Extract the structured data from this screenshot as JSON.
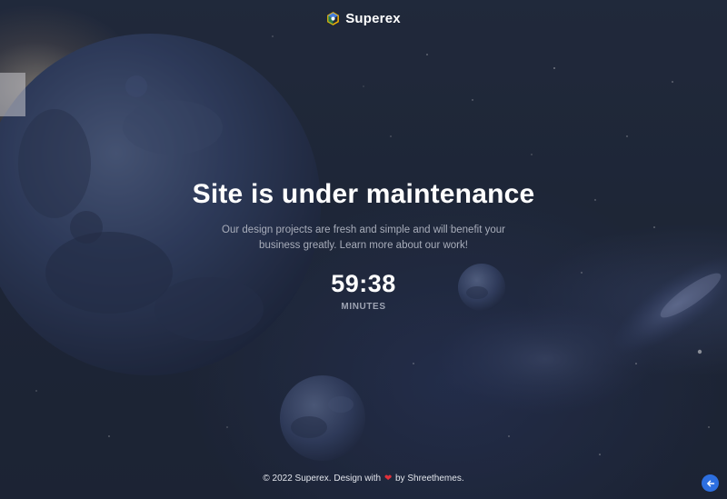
{
  "brand": {
    "name": "Superex",
    "logo_icon": "hexagon-logo-icon"
  },
  "hero": {
    "headline": "Site is under maintenance",
    "subtitle": "Our design projects are fresh and simple and will benefit your business greatly. Learn more about our work!"
  },
  "countdown": {
    "time": "59:38",
    "unit_label": "MINUTES"
  },
  "footer": {
    "prefix": "© 2022 Superex. Design with",
    "heart_icon": "heart-icon",
    "suffix": "by Shreethemes."
  },
  "back_to_top": {
    "icon": "arrow-left-icon"
  },
  "colors": {
    "accent": "#2d6fe0",
    "heart": "#e0303a",
    "background": "#222b3d"
  }
}
